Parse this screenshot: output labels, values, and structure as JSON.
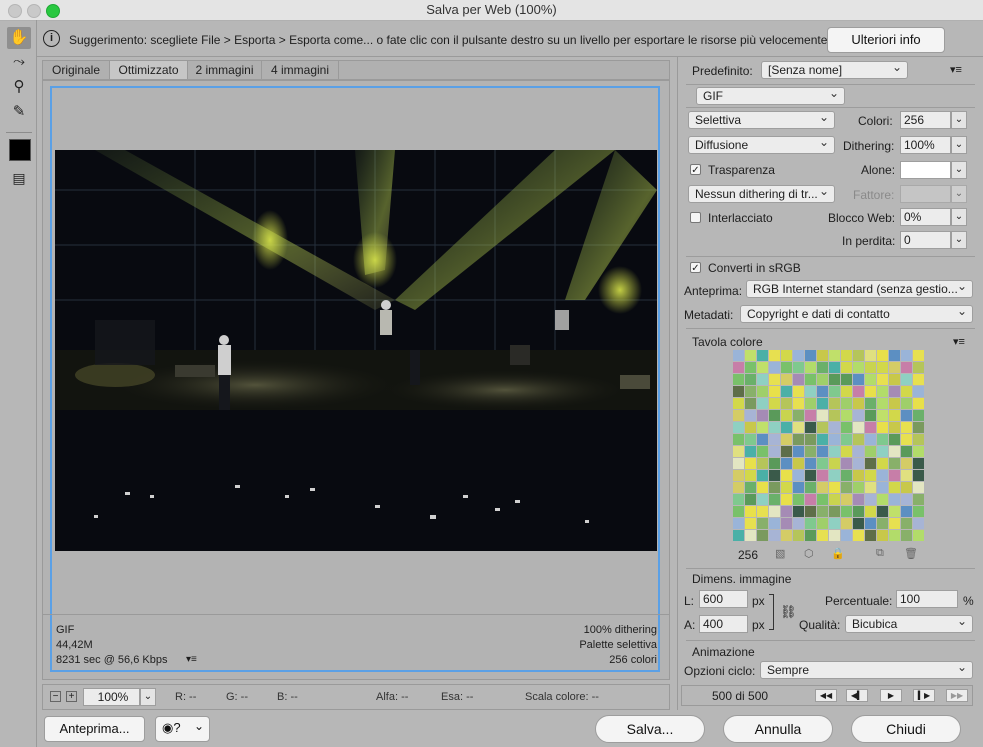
{
  "window": {
    "title": "Salva per Web (100%)"
  },
  "tools": [
    {
      "name": "hand-tool-icon",
      "glyph": "✋"
    },
    {
      "name": "slice-select-tool-icon",
      "glyph": "⤳"
    },
    {
      "name": "zoom-tool-icon",
      "glyph": "🔍"
    },
    {
      "name": "eyedropper-tool-icon",
      "glyph": "✎"
    },
    {
      "name": "toggle-slices-icon",
      "glyph": "▤"
    }
  ],
  "hint": {
    "text": "Suggerimento: scegliete File > Esporta > Esporta come... o fate clic con il pulsante destro su un livello per esportare le risorse più velocemente",
    "more_button": "Ulteriori info"
  },
  "tabs": [
    "Originale",
    "Ottimizzato",
    "2 immagini",
    "4 immagini"
  ],
  "preview_info": {
    "format": "GIF",
    "size": "44,42M",
    "time": "8231 sec @ 56,6 Kbps",
    "dithering": "100% dithering",
    "palette": "Palette selettiva",
    "colors": "256 colori"
  },
  "right": {
    "predefinito_label": "Predefinito:",
    "predefinito_value": "[Senza nome]",
    "format": "GIF",
    "reduction": "Selettiva",
    "colori_label": "Colori:",
    "colori_value": "256",
    "dither_algo": "Diffusione",
    "dithering_label": "Dithering:",
    "dithering_value": "100%",
    "trasparenza_label": "Trasparenza",
    "alone_label": "Alone:",
    "trans_dither": "Nessun dithering di tr...",
    "fattore_label": "Fattore:",
    "interlacciato_label": "Interlacciato",
    "blocco_web_label": "Blocco Web:",
    "blocco_web_value": "0%",
    "in_perdita_label": "In perdita:",
    "in_perdita_value": "0",
    "srgb_label": "Converti in sRGB",
    "anteprima_label": "Anteprima:",
    "anteprima_value": "RGB Internet standard (senza gestio...",
    "metadati_label": "Metadati:",
    "metadati_value": "Copyright e dati di contatto",
    "tavola_label": "Tavola colore",
    "color_count": "256",
    "dimens_label": "Dimens. immagine",
    "l_label": "L:",
    "l_value": "600",
    "a_label": "A:",
    "a_value": "400",
    "px": "px",
    "percentuale_label": "Percentuale:",
    "percentuale_value": "100",
    "percent_sign": "%",
    "qualita_label": "Qualità:",
    "qualita_value": "Bicubica",
    "animazione_label": "Animazione",
    "opzioni_label": "Opzioni ciclo:",
    "opzioni_value": "Sempre",
    "frame_counter": "500 di 500"
  },
  "footer": {
    "zoom": "100%",
    "r": "R: --",
    "g": "G: --",
    "b": "B: --",
    "alfa": "Alfa: --",
    "esa": "Esa: --",
    "scala": "Scala colore: --"
  },
  "buttons": {
    "anteprima": "Anteprima...",
    "salva": "Salva...",
    "annulla": "Annulla",
    "chiudi": "Chiudi"
  },
  "colors": {
    "accent": "#5aa0e6",
    "panel": "#b7b7b7",
    "close_red": "#fd5f57",
    "minimize": "#c9c9c9",
    "zoom_green": "#29c840"
  },
  "palette_colors": [
    "#a7b4d5",
    "#7fc98e",
    "#5c8fc2",
    "#4ab0a7",
    "#79c16a",
    "#c9d44f",
    "#e7e050",
    "#b5c55a",
    "#a58bb5",
    "#5a9a5a",
    "#88b06a",
    "#d2d84a",
    "#8fd0c2",
    "#9ab4d8",
    "#d4cc66",
    "#c0e06a",
    "#5e6e48",
    "#e8e04a",
    "#c77ea8",
    "#e3e6c2",
    "#9fcf6a",
    "#e0e080",
    "#7a9a5e",
    "#c8c84a",
    "#3a5a4a",
    "#b2dc6a",
    "#6ab06a"
  ]
}
